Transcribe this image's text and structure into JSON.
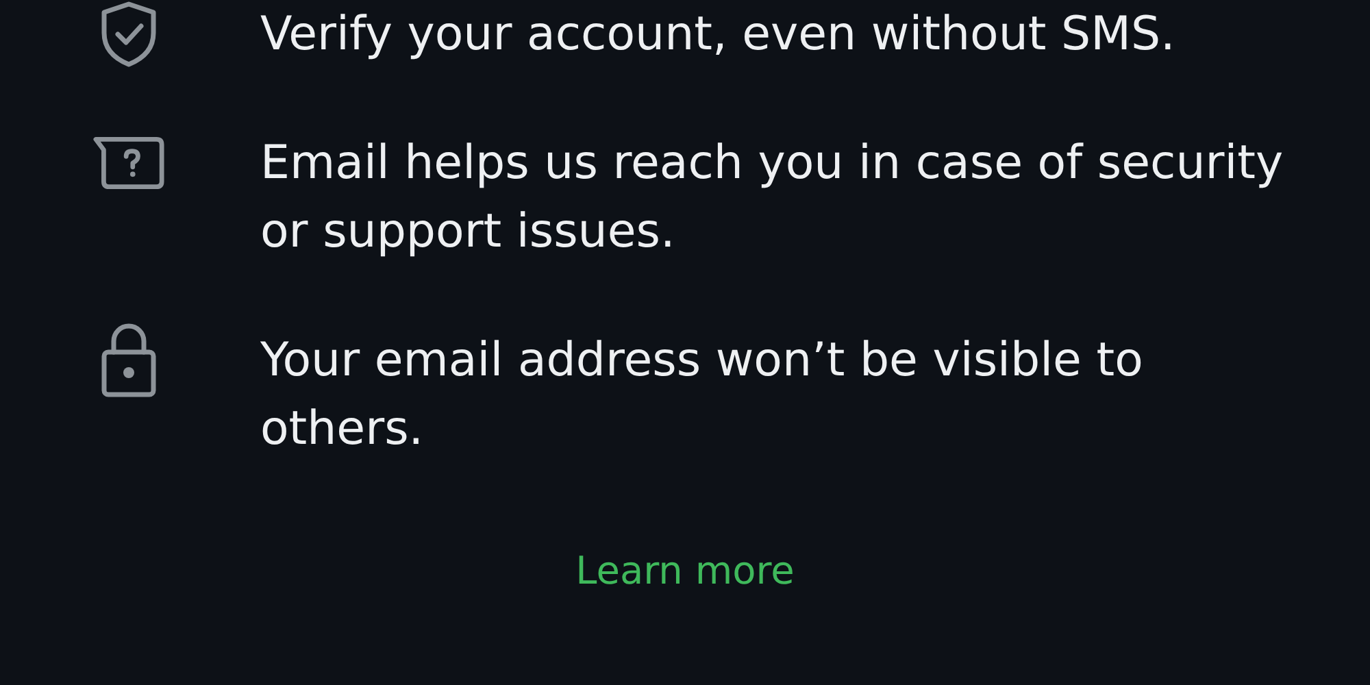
{
  "items": [
    {
      "kind": "shield",
      "text": "Verify your account, even without SMS."
    },
    {
      "kind": "help",
      "text": "Email helps us reach you in case of security or support issues."
    },
    {
      "kind": "lock",
      "text": "Your email address won’t be visible to others."
    }
  ],
  "link": "Learn more"
}
